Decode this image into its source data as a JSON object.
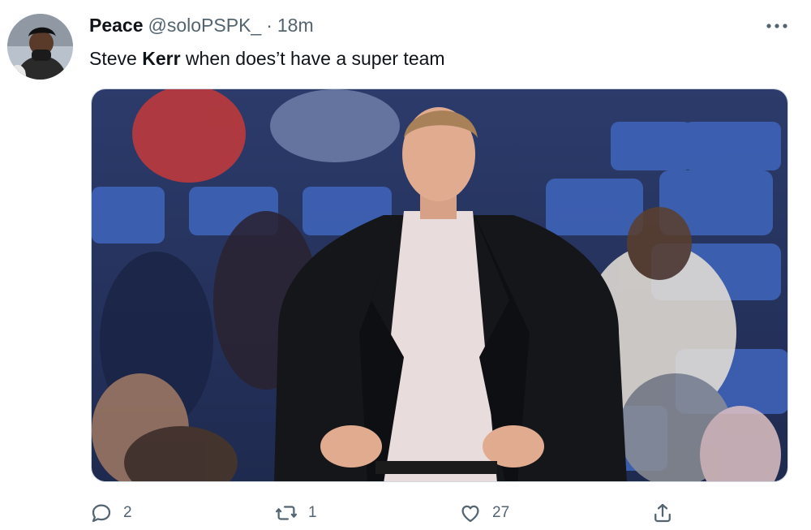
{
  "tweet": {
    "author_name": "Peace",
    "handle": "@soloPSPK_",
    "separator": "·",
    "time": "18m",
    "text_before": "Steve ",
    "text_bold": "Kerr",
    "text_after": " when does’t have a super team"
  },
  "actions": {
    "reply_count": "2",
    "retweet_count": "1",
    "like_count": "27"
  },
  "icons": {
    "more": "more-horizontal-icon",
    "reply": "reply-icon",
    "retweet": "retweet-icon",
    "like": "heart-icon",
    "share": "share-icon"
  },
  "colors": {
    "text_primary": "#0f1419",
    "text_secondary": "#536471",
    "media_border": "#cfd9de",
    "seat_blue": "#3f63b8"
  }
}
